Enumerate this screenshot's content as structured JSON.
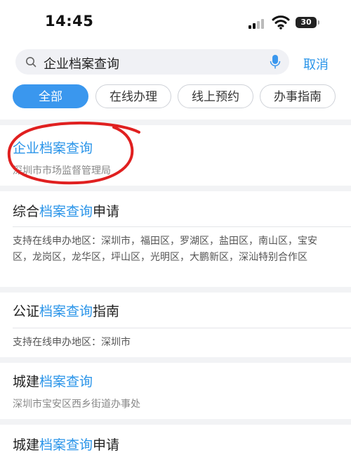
{
  "status_bar": {
    "time": "14:45",
    "battery": "30"
  },
  "search": {
    "query": "企业档案查询",
    "cancel_label": "取消"
  },
  "tabs": [
    {
      "label": "全部",
      "active": true
    },
    {
      "label": "在线办理",
      "active": false
    },
    {
      "label": "线上预约",
      "active": false
    },
    {
      "label": "办事指南",
      "active": false
    }
  ],
  "results": [
    {
      "title_pre": "",
      "title_hl": "企业档案查询",
      "title_post": "",
      "subtitle": "深圳市市场监督管理局"
    },
    {
      "title_pre": "综合",
      "title_hl": "档案查询",
      "title_post": "申请",
      "description": "支持在线申办地区：深圳市，福田区，罗湖区，盐田区，南山区，宝安区，龙岗区，龙华区，坪山区，光明区，大鹏新区，深汕特别合作区"
    },
    {
      "title_pre": "公证",
      "title_hl": "档案查询",
      "title_post": "指南",
      "description": "支持在线申办地区：深圳市"
    },
    {
      "title_pre": "城建",
      "title_hl": "档案查询",
      "title_post": "",
      "subtitle": "深圳市宝安区西乡街道办事处"
    },
    {
      "title_pre": "城建",
      "title_hl": "档案查询",
      "title_post": "申请"
    }
  ],
  "colors": {
    "accent": "#2b95e9",
    "annotation": "#e02020"
  }
}
